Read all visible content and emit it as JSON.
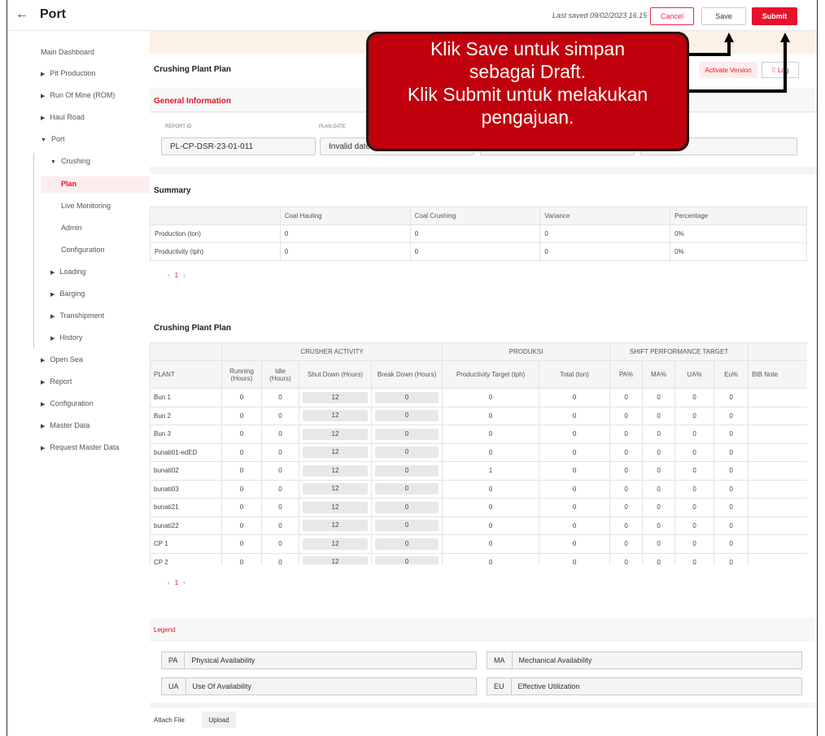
{
  "header": {
    "back_icon": "←",
    "title": "Port",
    "last_saved": "Last saved 09/02/2023 16.15",
    "cancel": "Cancel",
    "save": "Save",
    "submit": "Submit"
  },
  "sidebar": {
    "main_dashboard": "Main Dashboard",
    "pit_production": "Pit Production",
    "run_of_mine": "Run Of Mine (ROM)",
    "haul_road": "Haul Road",
    "port": "Port",
    "crushing": "Crushing",
    "plan": "Plan",
    "live_monitoring": "Live Monitoring",
    "admin": "Admin",
    "configuration_sub": "Configuration",
    "loading": "Loading",
    "barging": "Barging",
    "transhipment": "Transhipment",
    "history": "History",
    "open_sea": "Open Sea",
    "report": "Report",
    "configuration": "Configuration",
    "master_data": "Master Data",
    "request_master_data": "Request Master Data"
  },
  "plan_header": {
    "title": "Crushing Plant Plan",
    "activate_version": "Activate Version",
    "log": "Log"
  },
  "general": {
    "title": "General Information",
    "report_id_label": "REPORT ID",
    "report_id": "PL-CP-DSR-23-01-011",
    "plan_date_label": "PLAN DATE",
    "plan_date": "Invalid date"
  },
  "summary": {
    "title": "Summary",
    "columns": [
      "",
      "Coal Hauling",
      "Coal Crushing",
      "Variance",
      "Percentage"
    ],
    "rows": [
      [
        "Production (ton)",
        "0",
        "0",
        "0",
        "0%"
      ],
      [
        "Productivity (tph)",
        "0",
        "0",
        "0",
        "0%"
      ]
    ],
    "page": "1"
  },
  "plant_plan": {
    "title": "Crushing Plant Plan",
    "group_crusher": "CRUSHER ACTIVITY",
    "group_produksi": "PRODUKSI",
    "group_shift": "SHIFT PERFORMANCE TARGET",
    "col_plant": "PLANT",
    "col_running": "Running (Hours)",
    "col_idle": "Idle (Hours)",
    "col_shutdown": "Shut Down (Hours)",
    "col_breakdown": "Break Down (Hours)",
    "col_prod_target": "Productivity Target (tph)",
    "col_total": "Total (ton)",
    "col_pa": "PA%",
    "col_ma": "MA%",
    "col_ua": "UA%",
    "col_eu": "Eu%",
    "col_bib": "BIB Note",
    "rows": [
      {
        "plant": "Bun 1",
        "running": "0",
        "idle": "0",
        "shutdown": "12",
        "breakdown": "0",
        "target": "0",
        "total": "0",
        "pa": "0",
        "ma": "0",
        "ua": "0",
        "eu": "0"
      },
      {
        "plant": "Bun 2",
        "running": "0",
        "idle": "0",
        "shutdown": "12",
        "breakdown": "0",
        "target": "0",
        "total": "0",
        "pa": "0",
        "ma": "0",
        "ua": "0",
        "eu": "0"
      },
      {
        "plant": "Bun 3",
        "running": "0",
        "idle": "0",
        "shutdown": "12",
        "breakdown": "0",
        "target": "0",
        "total": "0",
        "pa": "0",
        "ma": "0",
        "ua": "0",
        "eu": "0"
      },
      {
        "plant": "bunati01-edED",
        "running": "0",
        "idle": "0",
        "shutdown": "12",
        "breakdown": "0",
        "target": "0",
        "total": "0",
        "pa": "0",
        "ma": "0",
        "ua": "0",
        "eu": "0"
      },
      {
        "plant": "bunati02",
        "running": "0",
        "idle": "0",
        "shutdown": "12",
        "breakdown": "0",
        "target": "1",
        "total": "0",
        "pa": "0",
        "ma": "0",
        "ua": "0",
        "eu": "0"
      },
      {
        "plant": "bunati03",
        "running": "0",
        "idle": "0",
        "shutdown": "12",
        "breakdown": "0",
        "target": "0",
        "total": "0",
        "pa": "0",
        "ma": "0",
        "ua": "0",
        "eu": "0"
      },
      {
        "plant": "bunati21",
        "running": "0",
        "idle": "0",
        "shutdown": "12",
        "breakdown": "0",
        "target": "0",
        "total": "0",
        "pa": "0",
        "ma": "0",
        "ua": "0",
        "eu": "0"
      },
      {
        "plant": "bunati22",
        "running": "0",
        "idle": "0",
        "shutdown": "12",
        "breakdown": "0",
        "target": "0",
        "total": "0",
        "pa": "0",
        "ma": "0",
        "ua": "0",
        "eu": "0"
      },
      {
        "plant": "CP 1",
        "running": "0",
        "idle": "0",
        "shutdown": "12",
        "breakdown": "0",
        "target": "0",
        "total": "0",
        "pa": "0",
        "ma": "0",
        "ua": "0",
        "eu": "0"
      },
      {
        "plant": "CP 2",
        "running": "0",
        "idle": "0",
        "shutdown": "12",
        "breakdown": "0",
        "target": "0",
        "total": "0",
        "pa": "0",
        "ma": "0",
        "ua": "0",
        "eu": "0"
      }
    ],
    "page": "1"
  },
  "legend": {
    "title": "Legend",
    "items": [
      {
        "code": "PA",
        "desc": "Physical Availability"
      },
      {
        "code": "MA",
        "desc": "Mechanical Availability"
      },
      {
        "code": "UA",
        "desc": "Use Of Availability"
      },
      {
        "code": "EU",
        "desc": "Effective Utilization"
      }
    ]
  },
  "attach": {
    "label": "Attach File",
    "upload": "Upload"
  },
  "callout": {
    "line1": "Klik Save untuk simpan",
    "line2": "sebagai Draft.",
    "line3": "Klik Submit untuk melakukan",
    "line4": "pengajuan."
  },
  "colors": {
    "accent": "#e8132b",
    "callout": "#c0000c"
  }
}
